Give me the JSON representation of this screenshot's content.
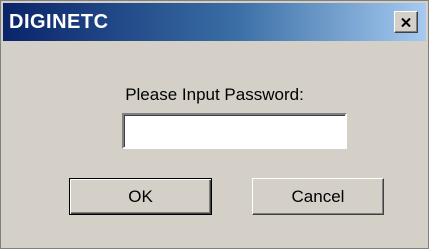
{
  "window": {
    "title": "DIGINETC",
    "close_icon": "close-x-icon"
  },
  "form": {
    "prompt": "Please Input Password:",
    "password_value": "",
    "ok_label": "OK",
    "cancel_label": "Cancel"
  },
  "colors": {
    "dialog_background": "#d4d0c8",
    "title_gradient_start": "#0a246a",
    "title_gradient_end": "#a6caf0",
    "title_text": "#ffffff"
  }
}
